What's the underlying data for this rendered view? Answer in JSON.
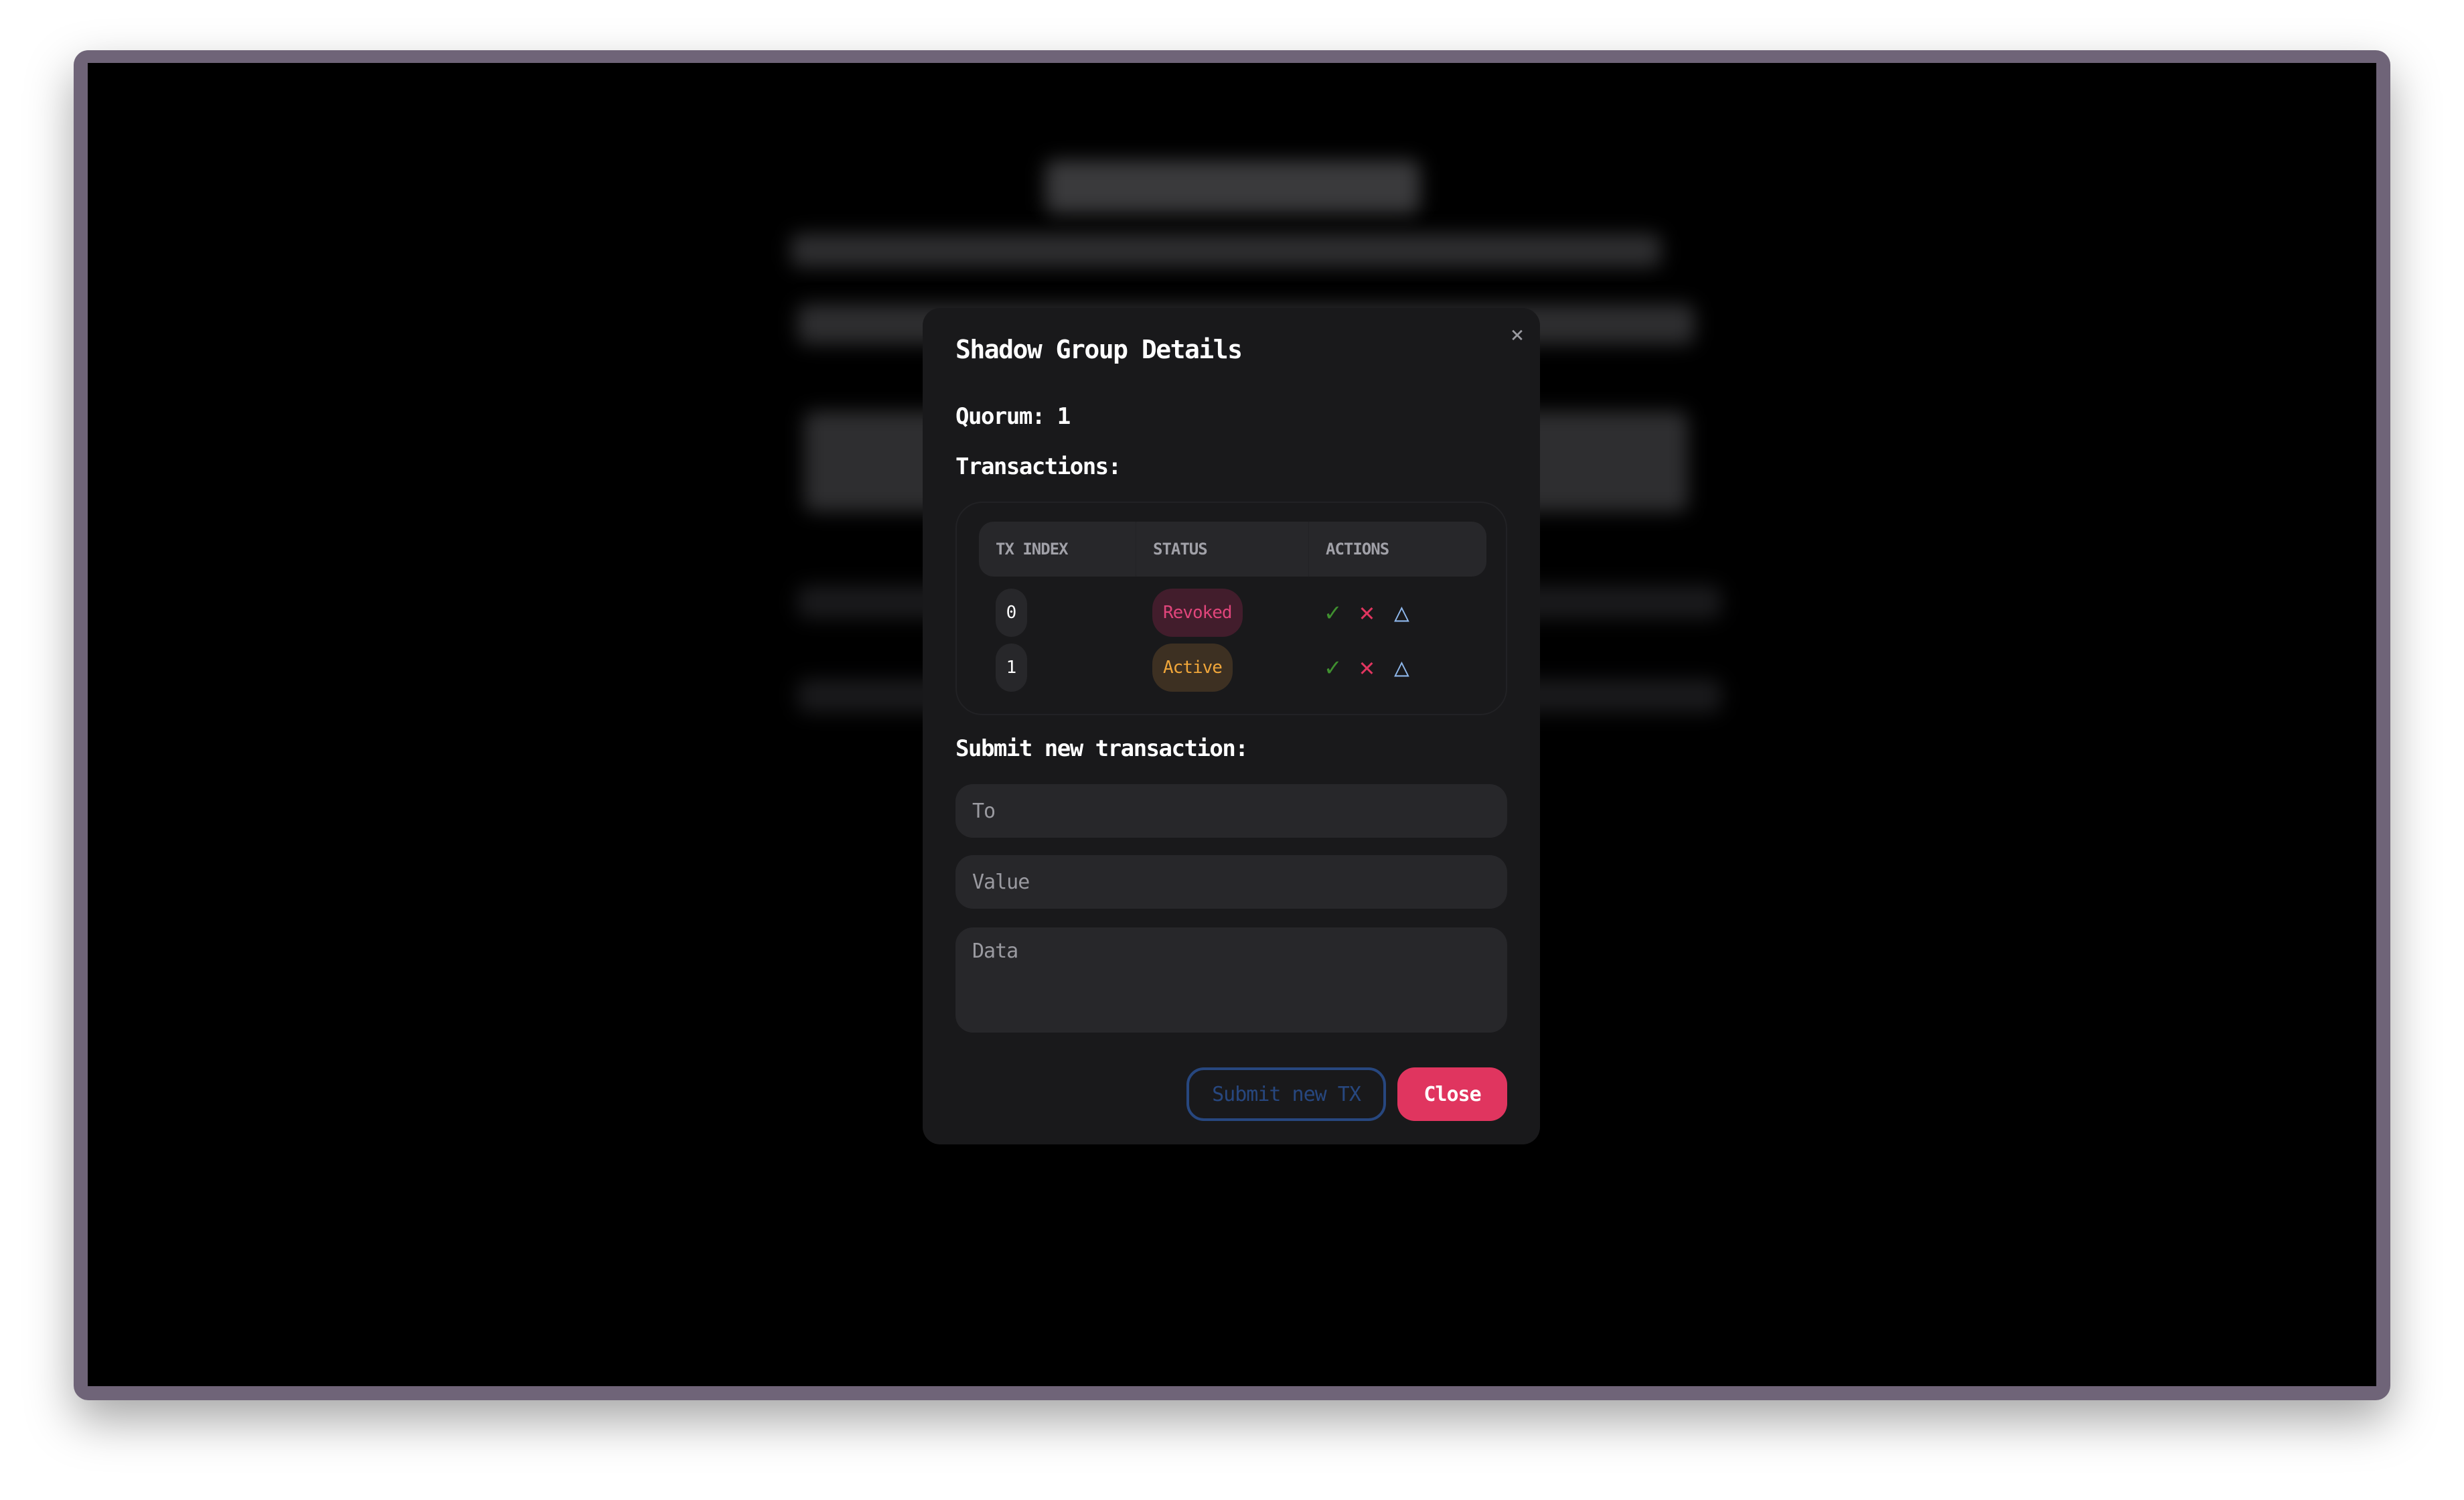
{
  "modal": {
    "title": "Shadow Group Details",
    "close_icon": "×",
    "quorum_label": "Quorum: 1",
    "transactions_label": "Transactions:",
    "table": {
      "headers": [
        "TX INDEX",
        "STATUS",
        "ACTIONS"
      ],
      "rows": [
        {
          "index": "0",
          "status": "Revoked",
          "status_color": "#e0457b",
          "status_bg": "#421d2c"
        },
        {
          "index": "1",
          "status": "Active",
          "status_color": "#f0a63a",
          "status_bg": "#3d3022"
        }
      ],
      "actions": {
        "approve_icon": "✓",
        "reject_icon": "✕",
        "execute_icon": "△"
      }
    },
    "submit_label": "Submit new transaction:",
    "form": {
      "to_placeholder": "To",
      "value_placeholder": "Value",
      "data_placeholder": "Data"
    },
    "buttons": {
      "submit": "Submit new TX",
      "close": "Close"
    }
  },
  "colors": {
    "accent": "#e0355f",
    "approve": "#3f8f2f",
    "reject": "#e0355f",
    "execute": "#8fb8ec",
    "submit_border": "#27477f"
  }
}
